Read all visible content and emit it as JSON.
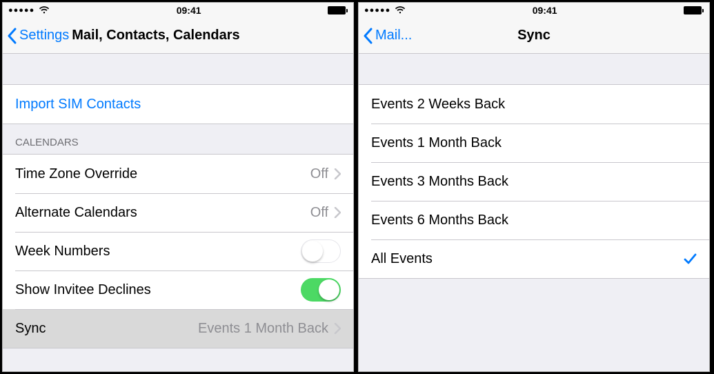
{
  "status": {
    "time": "09:41"
  },
  "left": {
    "back_label": "Settings",
    "title": "Mail, Contacts, Calendars",
    "import_label": "Import SIM Contacts",
    "calendars_header": "CALENDARS",
    "rows": {
      "timezone": {
        "label": "Time Zone Override",
        "value": "Off"
      },
      "alternate": {
        "label": "Alternate Calendars",
        "value": "Off"
      },
      "week_numbers": {
        "label": "Week Numbers",
        "on": false
      },
      "invitee_declines": {
        "label": "Show Invitee Declines",
        "on": true
      },
      "sync": {
        "label": "Sync",
        "value": "Events 1 Month Back"
      }
    }
  },
  "right": {
    "back_label": "Mail...",
    "title": "Sync",
    "options": [
      {
        "label": "Events 2 Weeks Back",
        "checked": false
      },
      {
        "label": "Events 1 Month Back",
        "checked": false
      },
      {
        "label": "Events 3 Months Back",
        "checked": false
      },
      {
        "label": "Events 6 Months Back",
        "checked": false
      },
      {
        "label": "All Events",
        "checked": true
      }
    ]
  }
}
